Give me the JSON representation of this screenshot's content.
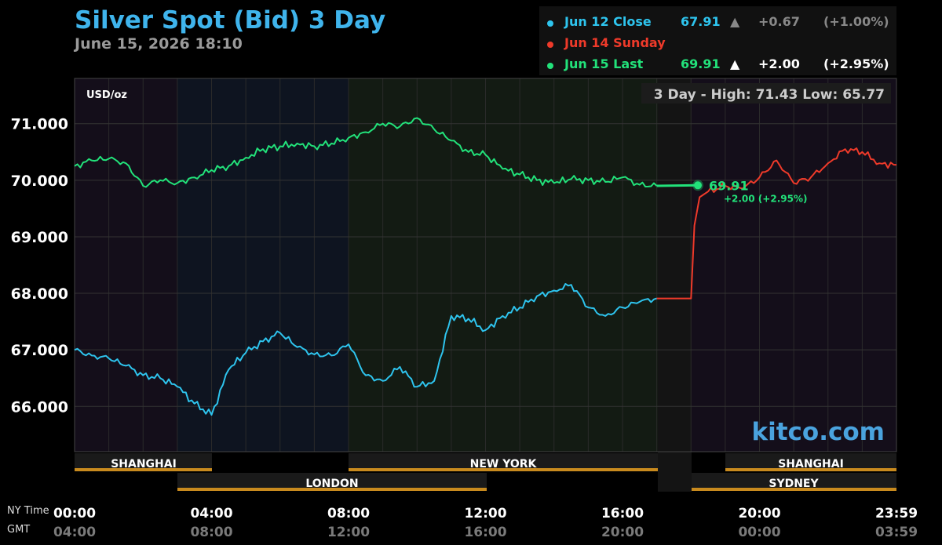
{
  "header": {
    "title": "Silver Spot (Bid) 3 Day",
    "subtitle": "June 15, 2026 18:10"
  },
  "legend": [
    {
      "label": "Jun 12 Close",
      "color": "#2ec4ee",
      "price": "67.91",
      "arrow": "▲",
      "change": "+0.67",
      "percent": "(+1.00%)",
      "dim": true
    },
    {
      "label": "Jun 14 Sunday",
      "color": "#ef3a2a",
      "price": "",
      "arrow": "",
      "change": "",
      "percent": "",
      "dim": false
    },
    {
      "label": "Jun 15 Last",
      "color": "#22e27a",
      "price": "69.91",
      "arrow": "▲",
      "change": "+2.00",
      "percent": "(+2.95%)",
      "dim": false
    }
  ],
  "info": {
    "unit": "USD/oz",
    "range_text": "3 Day - High: 71.43  Low: 65.77",
    "last_price": "69.91",
    "last_change": "+2.00 (+2.95%)",
    "watermark": "kitco.com"
  },
  "axis_labels": {
    "ny_time": "NY Time",
    "gmt": "GMT",
    "ny_ticks": [
      "00:00",
      "04:00",
      "08:00",
      "12:00",
      "16:00",
      "20:00",
      "23:59"
    ],
    "gmt_ticks": [
      "04:00",
      "08:00",
      "12:00",
      "16:00",
      "20:00",
      "00:00",
      "03:59"
    ]
  },
  "sessions": {
    "row1": [
      "SHANGHAI",
      "NEW YORK",
      "SHANGHAI"
    ],
    "row2": [
      "LONDON",
      "SYDNEY"
    ]
  },
  "chart_data": {
    "type": "line",
    "title": "Silver Spot (Bid) 3 Day",
    "ylabel": "USD/oz",
    "ylim": [
      65.2,
      71.8
    ],
    "xlim": [
      0,
      24
    ],
    "yticks": [
      "66.000",
      "67.000",
      "68.000",
      "69.000",
      "70.000",
      "71.000"
    ],
    "ytick_values": [
      66,
      67,
      68,
      69,
      70,
      71
    ],
    "series": [
      {
        "name": "Jun 12 Close",
        "color": "#2ec4ee",
        "x": [
          0,
          0.5,
          1,
          1.5,
          2,
          2.5,
          3,
          3.5,
          4,
          4.5,
          5,
          5.5,
          6,
          6.5,
          7,
          7.5,
          8,
          8.5,
          9,
          9.5,
          10,
          10.5,
          11,
          11.5,
          12,
          12.5,
          13,
          13.5,
          14,
          14.5,
          15,
          15.5,
          16,
          16.5,
          17
        ],
        "y": [
          67.0,
          66.9,
          66.85,
          66.72,
          66.55,
          66.5,
          66.35,
          66.05,
          65.85,
          66.65,
          66.95,
          67.15,
          67.3,
          67.05,
          66.92,
          66.9,
          67.1,
          66.55,
          66.45,
          66.7,
          66.35,
          66.45,
          67.6,
          67.55,
          67.35,
          67.6,
          67.75,
          67.95,
          68.05,
          68.15,
          67.75,
          67.6,
          67.75,
          67.85,
          67.91
        ]
      },
      {
        "name": "Jun 14 Sunday",
        "color": "#ef3a2a",
        "x": [
          17,
          18,
          18.1,
          18.25,
          18.5,
          19,
          19.5,
          20,
          20.5,
          21,
          21.5,
          22,
          22.5,
          23,
          23.5,
          24
        ],
        "y": [
          67.91,
          67.91,
          69.2,
          69.7,
          69.8,
          69.9,
          69.85,
          70.05,
          70.35,
          69.95,
          70.05,
          70.3,
          70.55,
          70.5,
          70.3,
          70.27
        ]
      },
      {
        "name": "Jun 15 Last",
        "color": "#22e27a",
        "x": [
          0,
          0.5,
          1,
          1.5,
          2,
          2.5,
          3,
          3.5,
          4,
          4.5,
          5,
          5.5,
          6,
          6.5,
          7,
          7.5,
          8,
          8.5,
          9,
          9.5,
          10,
          10.5,
          11,
          11.5,
          12,
          12.5,
          13,
          13.5,
          14,
          14.5,
          15,
          15.5,
          16,
          16.5,
          17,
          18.2
        ],
        "y": [
          70.25,
          70.35,
          70.38,
          70.3,
          69.9,
          70.0,
          69.95,
          70.05,
          70.18,
          70.25,
          70.4,
          70.55,
          70.6,
          70.65,
          70.6,
          70.65,
          70.75,
          70.85,
          71.0,
          70.95,
          71.1,
          70.9,
          70.7,
          70.5,
          70.45,
          70.2,
          70.1,
          70.0,
          69.95,
          70.02,
          70.0,
          69.97,
          70.05,
          69.92,
          69.9,
          69.91
        ]
      }
    ]
  },
  "colors": {
    "background": "#000000",
    "title": "#3fb4ec",
    "session_bar": "#c88a1e"
  }
}
